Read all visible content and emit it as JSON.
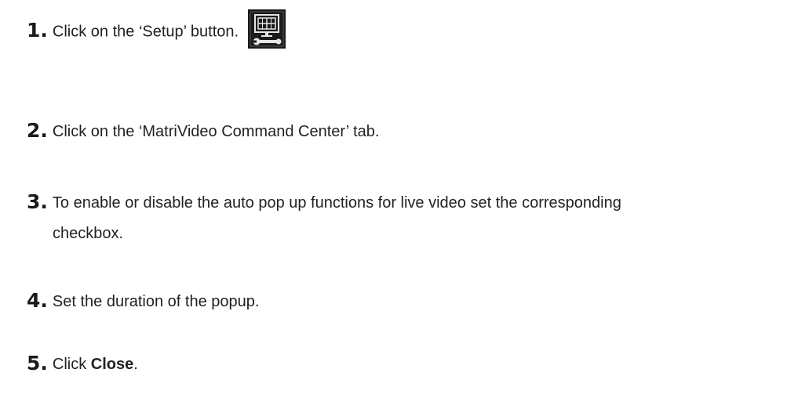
{
  "steps": [
    {
      "number": "1.",
      "text": "Click on the ‘Setup’ button.",
      "icon": "setup-monitor-wrench-icon"
    },
    {
      "number": "2.",
      "text": "Click on the ‘MatriVideo Command Center’ tab."
    },
    {
      "number": "3.",
      "text": "To enable or disable the auto pop up functions for live video set the corresponding",
      "text_cont": "checkbox."
    },
    {
      "number": "4.",
      "text": "Set the duration of the popup."
    },
    {
      "number": "5.",
      "text_before": "Click ",
      "bold": "Close",
      "text_after": "."
    }
  ],
  "colors": {
    "text": "#222222",
    "icon_bg": "#1b1b1b",
    "icon_fg": "#e6e6e6"
  }
}
